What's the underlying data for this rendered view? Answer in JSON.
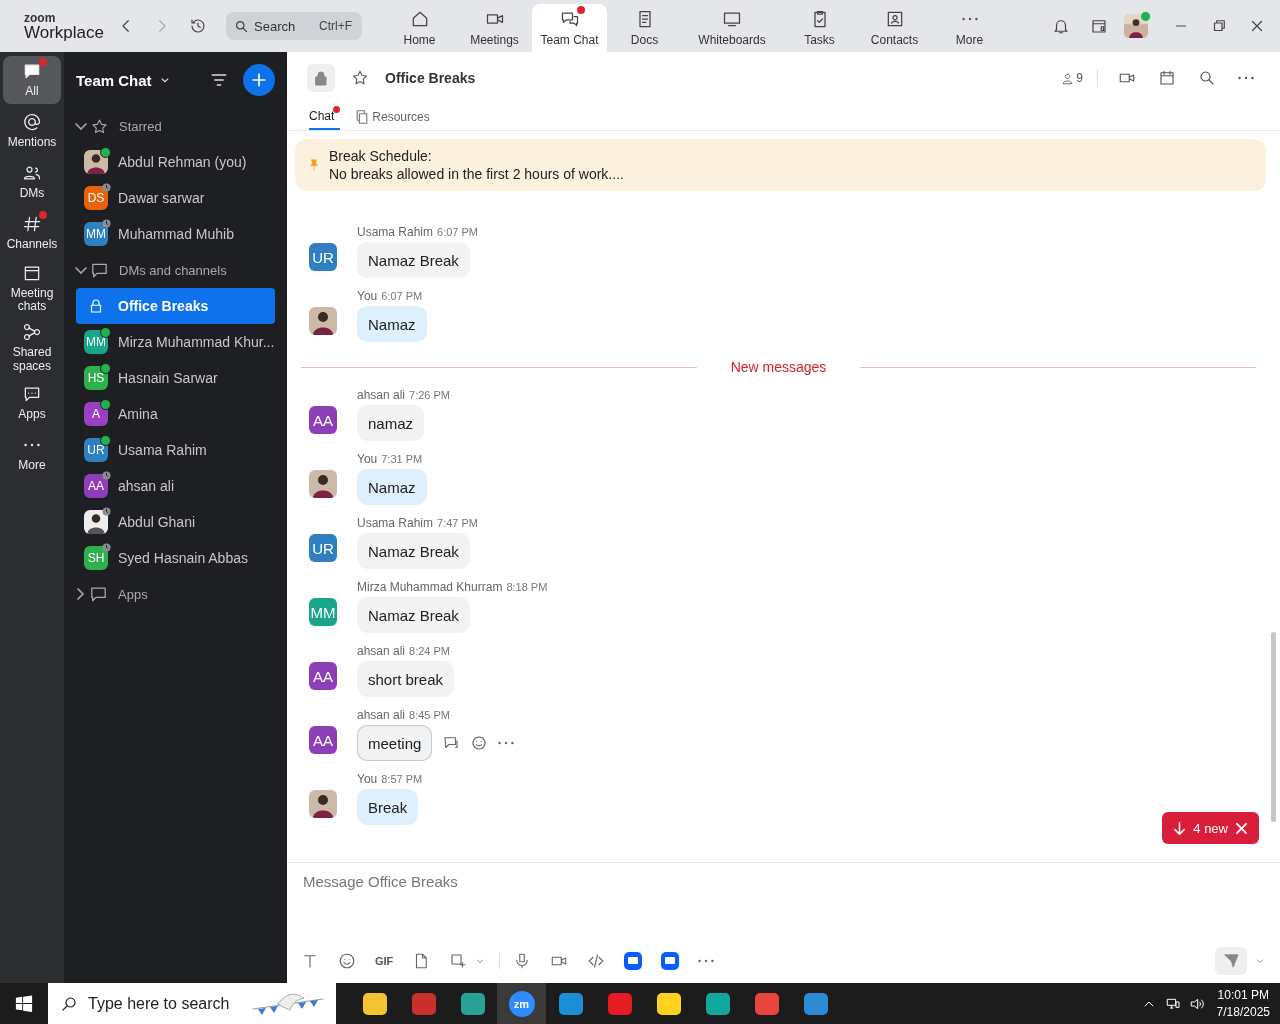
{
  "app": {
    "logo_top": "zoom",
    "logo_bottom": "Workplace",
    "search": {
      "placeholder": "Search",
      "shortcut": "Ctrl+F"
    }
  },
  "nav": [
    {
      "label": "Home",
      "selected": false,
      "badge": false
    },
    {
      "label": "Meetings",
      "selected": false,
      "badge": false
    },
    {
      "label": "Team Chat",
      "selected": true,
      "badge": true
    },
    {
      "label": "Docs",
      "selected": false,
      "badge": false
    },
    {
      "label": "Whiteboards",
      "selected": false,
      "badge": false
    },
    {
      "label": "Tasks",
      "selected": false,
      "badge": false
    },
    {
      "label": "Contacts",
      "selected": false,
      "badge": false
    },
    {
      "label": "More",
      "selected": false,
      "badge": false
    }
  ],
  "rail": [
    {
      "label": "All",
      "selected": true,
      "badge": true
    },
    {
      "label": "Mentions",
      "selected": false,
      "badge": false
    },
    {
      "label": "DMs",
      "selected": false,
      "badge": false
    },
    {
      "label": "Channels",
      "selected": false,
      "badge": true
    },
    {
      "label": "Meeting chats",
      "selected": false,
      "badge": false
    },
    {
      "label": "Shared spaces",
      "selected": false,
      "badge": false
    },
    {
      "label": "Apps",
      "selected": false,
      "badge": false
    },
    {
      "label": "More",
      "selected": false,
      "badge": false
    }
  ],
  "sidebar": {
    "title": "Team Chat",
    "sections": [
      {
        "label": "Starred",
        "expanded": true,
        "items": [
          {
            "name": "Abdul Rehman (you)",
            "online": true,
            "selected": false
          },
          {
            "name": "Dawar sarwar",
            "avatar": {
              "kind": "initials",
              "initials": "DS",
              "color": "#e8630a"
            },
            "online": false,
            "selected": false
          },
          {
            "name": "Muhammad Muhib",
            "avatar": {
              "kind": "initials",
              "initials": "MM",
              "color": "#2f7fc1"
            },
            "online": false,
            "selected": false
          }
        ]
      },
      {
        "label": "DMs and channels",
        "expanded": true,
        "items": [
          {
            "name": "Office Breaks",
            "avatar": {
              "kind": "channel"
            },
            "selected": true
          },
          {
            "name": "Mirza Muhammad Khur...",
            "avatar": {
              "kind": "initials",
              "initials": "MM",
              "color": "#18a58a"
            },
            "online": true,
            "selected": false
          },
          {
            "name": "Hasnain Sarwar",
            "avatar": {
              "kind": "initials",
              "initials": "HS",
              "color": "#2fb04f"
            },
            "online": true,
            "selected": false
          },
          {
            "name": "Amina",
            "avatar": {
              "kind": "initials",
              "initials": "A",
              "color": "#9b3fc3"
            },
            "online": true,
            "selected": false
          },
          {
            "name": "Usama Rahim",
            "avatar": {
              "kind": "initials",
              "initials": "UR",
              "color": "#2f7fc1"
            },
            "online": true,
            "selected": false
          },
          {
            "name": "ahsan ali",
            "avatar": {
              "kind": "initials",
              "initials": "AA",
              "color": "#8e3fb8"
            },
            "online": false,
            "selected": false
          },
          {
            "name": "Abdul Ghani",
            "online": false,
            "selected": false
          },
          {
            "name": "Syed Hasnain Abbas",
            "avatar": {
              "kind": "initials",
              "initials": "SH",
              "color": "#2fb04f"
            },
            "online": false,
            "selected": false
          }
        ]
      },
      {
        "label": "Apps",
        "expanded": false
      }
    ]
  },
  "channel": {
    "title": "Office Breaks",
    "members": "9",
    "tabs": [
      {
        "label": "Chat",
        "selected": true,
        "badge": true
      },
      {
        "label": "Resources",
        "selected": false,
        "badge": false
      }
    ],
    "pinned": {
      "title": "Break Schedule:",
      "text": "No breaks allowed in the first 2 hours of work...."
    }
  },
  "messages": [
    {
      "kind": "message",
      "sender": "Usama Rahim",
      "time": "6:07 PM",
      "text": "Namaz Break",
      "avatar": {
        "kind": "initials",
        "initials": "UR",
        "color": "#2f7fc1"
      },
      "mine": false,
      "hovered": false
    },
    {
      "kind": "message",
      "sender": "You",
      "time": "6:07 PM",
      "text": "Namaz",
      "mine": true,
      "hovered": false
    },
    {
      "kind": "divider",
      "text": "New messages"
    },
    {
      "kind": "message",
      "sender": "ahsan ali",
      "time": "7:26 PM",
      "text": "namaz",
      "avatar": {
        "kind": "initials",
        "initials": "AA",
        "color": "#8e3fb8"
      },
      "mine": false,
      "hovered": false
    },
    {
      "kind": "message",
      "sender": "You",
      "time": "7:31 PM",
      "text": "Namaz",
      "mine": true,
      "hovered": false
    },
    {
      "kind": "message",
      "sender": "Usama Rahim",
      "time": "7:47 PM",
      "text": "Namaz Break",
      "avatar": {
        "kind": "initials",
        "initials": "UR",
        "color": "#2f7fc1"
      },
      "mine": false,
      "hovered": false
    },
    {
      "kind": "message",
      "sender": "Mirza Muhammad Khurram",
      "time": "8:18 PM",
      "text": "Namaz Break",
      "avatar": {
        "kind": "initials",
        "initials": "MM",
        "color": "#18a58a"
      },
      "mine": false,
      "hovered": false
    },
    {
      "kind": "message",
      "sender": "ahsan ali",
      "time": "8:24 PM",
      "text": "short break",
      "avatar": {
        "kind": "initials",
        "initials": "AA",
        "color": "#8e3fb8"
      },
      "mine": false,
      "hovered": false
    },
    {
      "kind": "message",
      "sender": "ahsan ali",
      "time": "8:45 PM",
      "text": "meeting",
      "avatar": {
        "kind": "initials",
        "initials": "AA",
        "color": "#8e3fb8"
      },
      "mine": false,
      "hovered": true
    },
    {
      "kind": "message",
      "sender": "You",
      "time": "8:57 PM",
      "text": "Break",
      "mine": true,
      "hovered": false
    }
  ],
  "new_pill": "4 new",
  "composer": {
    "placeholder": "Message Office Breaks",
    "gif": "GIF"
  },
  "taskbar": {
    "search": {
      "placeholder": "Type here to search"
    },
    "zoom_app": "zm",
    "time": "10:01 PM",
    "date": "7/18/2025"
  }
}
